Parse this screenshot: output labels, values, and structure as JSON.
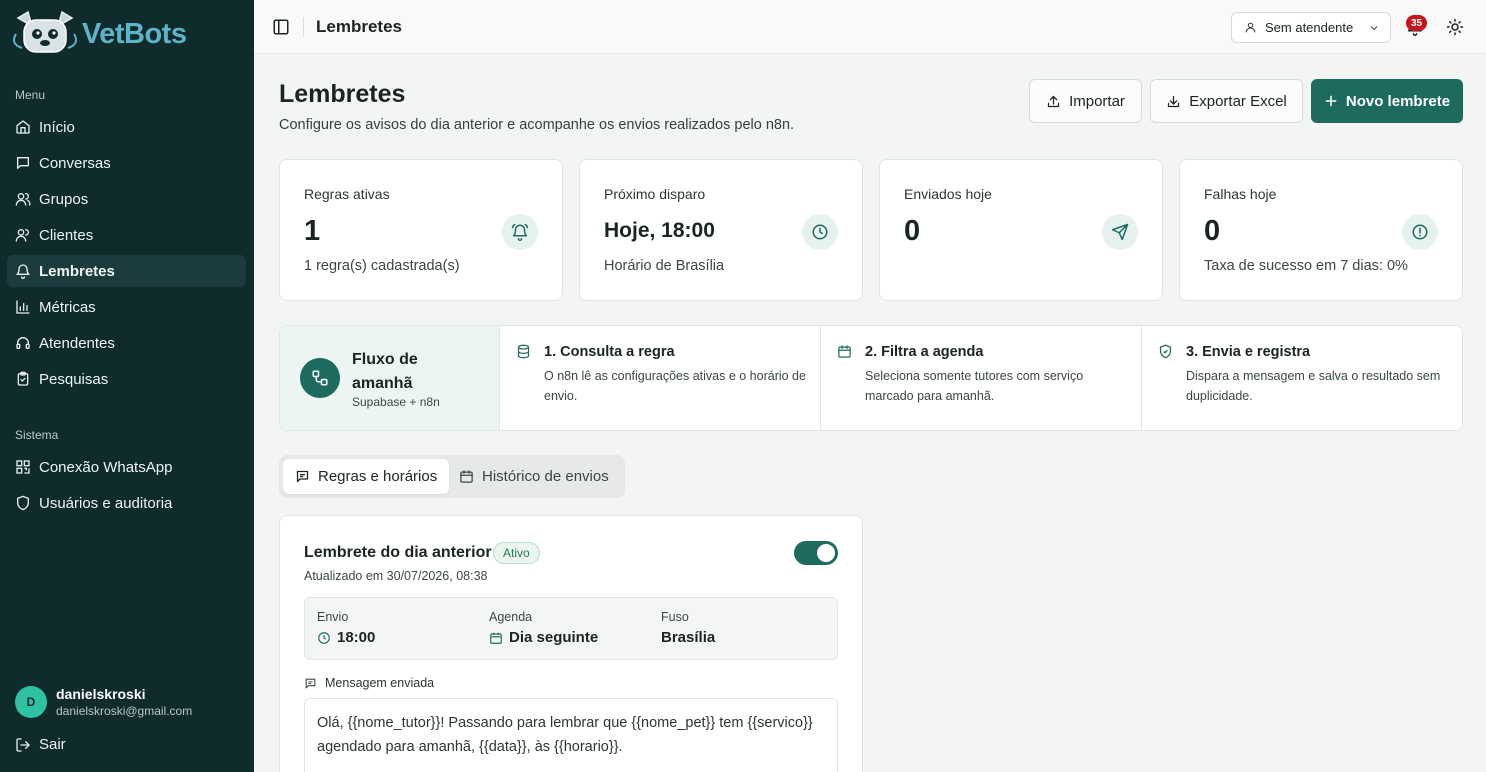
{
  "brand": {
    "name": "VetBots"
  },
  "sidebar": {
    "menu_label": "Menu",
    "items": [
      {
        "label": "Início",
        "icon": "home-icon"
      },
      {
        "label": "Conversas",
        "icon": "chat-icon"
      },
      {
        "label": "Grupos",
        "icon": "users-icon"
      },
      {
        "label": "Clientes",
        "icon": "user-icon"
      },
      {
        "label": "Lembretes",
        "icon": "bell-icon",
        "active": true
      },
      {
        "label": "Métricas",
        "icon": "bar-chart-icon"
      },
      {
        "label": "Atendentes",
        "icon": "headset-icon"
      },
      {
        "label": "Pesquisas",
        "icon": "clipboard-icon"
      }
    ],
    "system_label": "Sistema",
    "system_items": [
      {
        "label": "Conexão WhatsApp",
        "icon": "qr-code-icon"
      },
      {
        "label": "Usuários e auditoria",
        "icon": "shield-icon"
      }
    ],
    "user": {
      "initial": "D",
      "name": "danielskroski",
      "email": "danielskroski@gmail.com"
    },
    "logout_label": "Sair"
  },
  "topbar": {
    "title": "Lembretes",
    "attendant_select": "Sem atendente",
    "notification_count": "35"
  },
  "header": {
    "title": "Lembretes",
    "subtitle": "Configure os avisos do dia anterior e acompanhe os envios realizados pelo n8n.",
    "import_label": "Importar",
    "export_label": "Exportar Excel",
    "new_label": "Novo lembrete"
  },
  "stats": [
    {
      "title": "Regras ativas",
      "value": "1",
      "foot": "1 regra(s) cadastrada(s)",
      "icon": "bell-ring-icon"
    },
    {
      "title": "Próximo disparo",
      "value": "Hoje, 18:00",
      "foot": "Horário de Brasília",
      "icon": "clock-icon"
    },
    {
      "title": "Enviados hoje",
      "value": "0",
      "foot": "",
      "icon": "send-icon"
    },
    {
      "title": "Falhas hoje",
      "value": "0",
      "foot": "Taxa de sucesso em 7 dias: 0%",
      "icon": "alert-circle-icon"
    }
  ],
  "flow": {
    "title": "Fluxo de amanhã",
    "subtitle": "Supabase + n8n",
    "steps": [
      {
        "title": "1. Consulta a regra",
        "desc": "O n8n lê as configurações ativas e o horário de envio.",
        "icon": "database-icon"
      },
      {
        "title": "2. Filtra a agenda",
        "desc": "Seleciona somente tutores com serviço marcado para amanhã.",
        "icon": "calendar-icon"
      },
      {
        "title": "3. Envia e registra",
        "desc": "Dispara a mensagem e salva o resultado sem duplicidade.",
        "icon": "shield-check-icon"
      }
    ]
  },
  "tabs": [
    {
      "label": "Regras e horários",
      "active": true
    },
    {
      "label": "Histórico de envios",
      "active": false
    }
  ],
  "rule": {
    "title": "Lembrete do dia anterior",
    "status": "Ativo",
    "enabled": true,
    "updated": "Atualizado em 30/07/2026, 08:38",
    "send_label": "Envio",
    "send_value": "18:00",
    "agenda_label": "Agenda",
    "agenda_value": "Dia seguinte",
    "tz_label": "Fuso",
    "tz_value": "Brasília",
    "message_label": "Mensagem enviada",
    "message": "Olá, {{nome_tutor}}! Passando para lembrar que {{nome_pet}} tem {{servico}} agendado para amanhã, {{data}}, às {{horario}}."
  },
  "colors": {
    "sidebar_bg": "#0f2b2c",
    "accent": "#1d6b5f",
    "badge": "#c4161c"
  }
}
